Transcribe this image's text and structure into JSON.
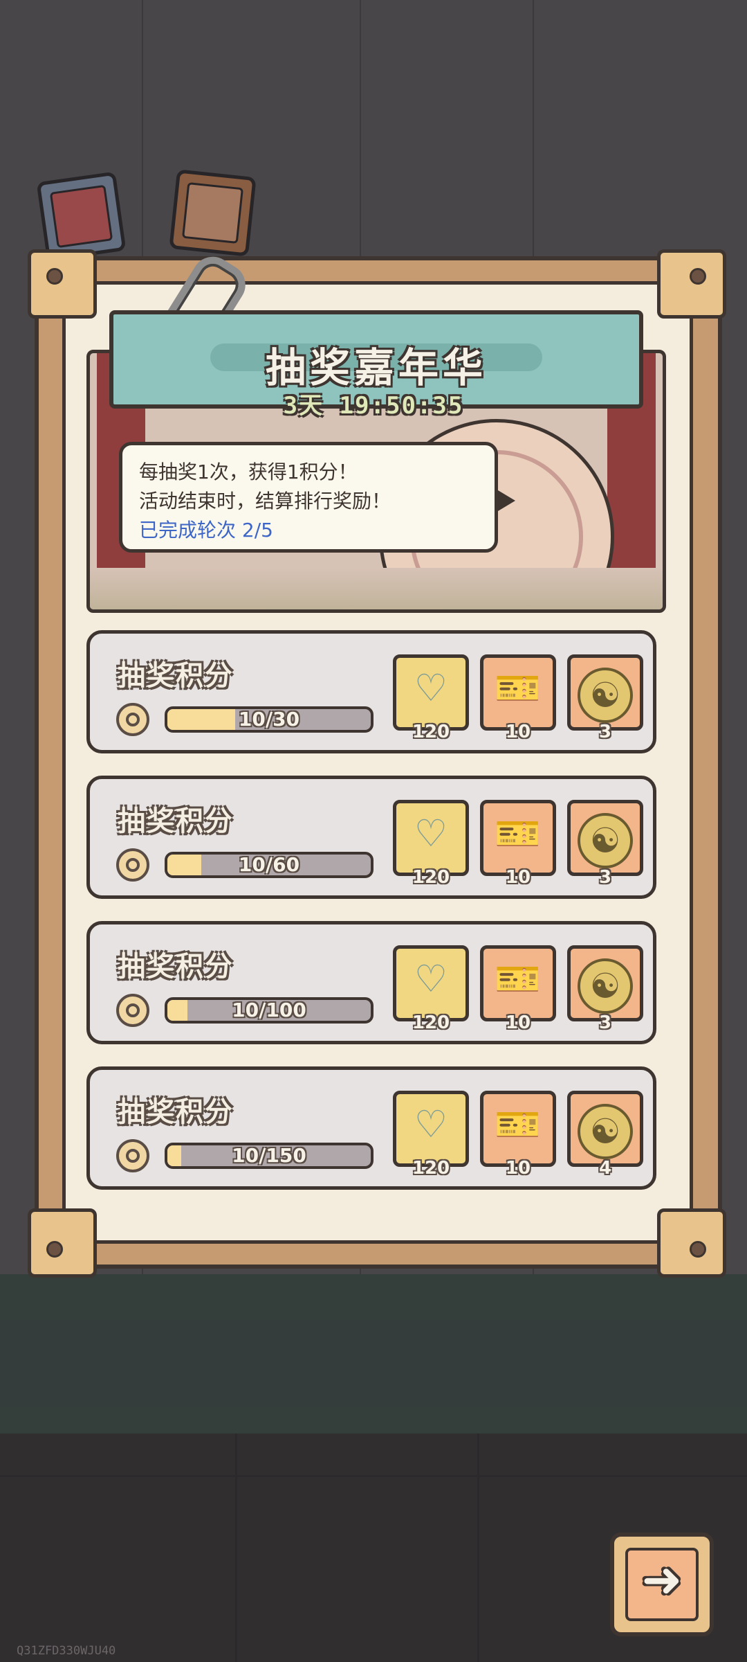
{
  "event": {
    "title": "抽奖嘉年华",
    "timer": "3天 19:50:35",
    "info_line1": "每抽奖1次，获得1积分！",
    "info_line2": "活动结束时，结算排行奖励！",
    "rounds": "已完成轮次 2/5"
  },
  "rows": [
    {
      "label": "抽奖积分",
      "progress_text": "10/30",
      "progress": 0.333,
      "rewards": [
        {
          "icon": "net-icon",
          "count": "120"
        },
        {
          "icon": "ticket-icon",
          "count": "10"
        },
        {
          "icon": "yinyang-coin-icon",
          "count": "3"
        }
      ]
    },
    {
      "label": "抽奖积分",
      "progress_text": "10/60",
      "progress": 0.167,
      "rewards": [
        {
          "icon": "net-icon",
          "count": "120"
        },
        {
          "icon": "ticket-icon",
          "count": "10"
        },
        {
          "icon": "yinyang-coin-icon",
          "count": "3"
        }
      ]
    },
    {
      "label": "抽奖积分",
      "progress_text": "10/100",
      "progress": 0.1,
      "rewards": [
        {
          "icon": "net-icon",
          "count": "120"
        },
        {
          "icon": "ticket-icon",
          "count": "10"
        },
        {
          "icon": "yinyang-coin-icon",
          "count": "3"
        }
      ]
    },
    {
      "label": "抽奖积分",
      "progress_text": "10/150",
      "progress": 0.067,
      "rewards": [
        {
          "icon": "net-icon",
          "count": "120"
        },
        {
          "icon": "ticket-icon",
          "count": "10"
        },
        {
          "icon": "yinyang-coin-icon",
          "count": "4"
        }
      ]
    }
  ],
  "footer": {
    "watermark": "Q31ZFD330WJU40",
    "next_icon": "right-arrow-icon"
  },
  "colors": {
    "panel": "#c69b71",
    "paper": "#f4ecdc",
    "title_plate": "#8ec3be",
    "progress_fill": "#f7dc9a",
    "rounds_text": "#3e66c7"
  }
}
